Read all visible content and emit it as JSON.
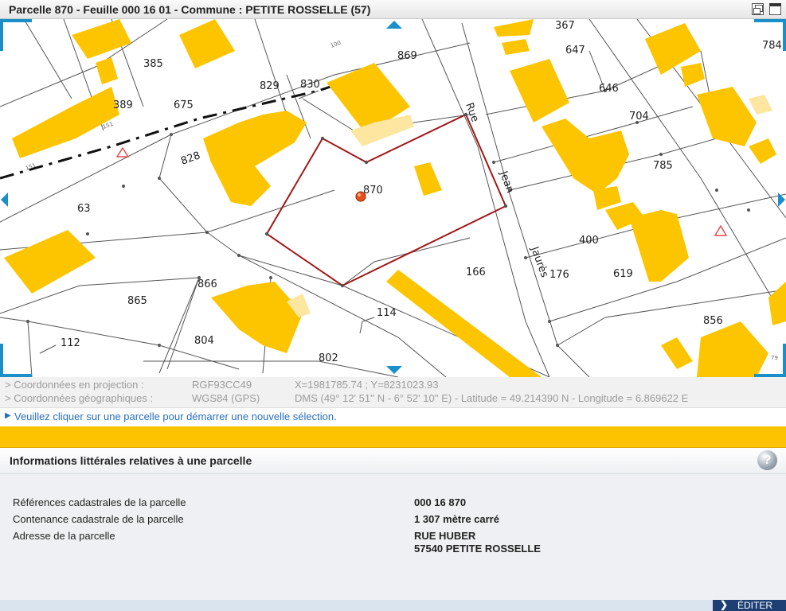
{
  "window": {
    "title": "Parcelle 870 - Feuille 000 16 01 - Commune : PETITE ROSSELLE (57)"
  },
  "map": {
    "selected_parcel": "870",
    "parcel_labels": [
      "367",
      "647",
      "784",
      "385",
      "869",
      "646",
      "704",
      "675",
      "829",
      "830",
      "389",
      "828",
      "785",
      "870",
      "63",
      "400",
      "619",
      "166",
      "176",
      "866",
      "865",
      "856",
      "114",
      "804",
      "112",
      "802"
    ],
    "street_words": [
      "Rue",
      "Jean",
      "Jaurès"
    ],
    "small_labels": [
      "100",
      "151",
      "151",
      "79"
    ],
    "colors": {
      "building": "#fdc500",
      "building_light": "#fde6a0",
      "selection_outline": "#a01818",
      "nav_arrow": "#1a8fc8",
      "marker": "#e8501a"
    }
  },
  "coords": {
    "projection_label": "> Coordonnées en projection :",
    "projection_system": "RGF93CC49",
    "projection_value": "X=1981785.74 ; Y=8231023.93",
    "geo_label": "> Coordonnées géographiques :",
    "geo_system": "WGS84 (GPS)",
    "geo_value": "DMS (49° 12' 51'' N - 6° 52' 10'' E) - Latitude = 49.214390 N - Longitude = 6.869622 E"
  },
  "hint": {
    "text": "Veuillez cliquer sur une parcelle pour démarrer une nouvelle sélection."
  },
  "panel": {
    "title": "Informations littérales relatives à une parcelle",
    "help_label": "?",
    "rows": [
      {
        "label": "Références cadastrales de la parcelle",
        "value": "000 16 870"
      },
      {
        "label": "Contenance cadastrale de la parcelle",
        "value": "1 307 mètre carré"
      },
      {
        "label": "Adresse de la parcelle",
        "value": "RUE HUBER",
        "value2": "57540 PETITE ROSSELLE"
      }
    ]
  },
  "footer": {
    "edit_label": "ÉDITER"
  }
}
